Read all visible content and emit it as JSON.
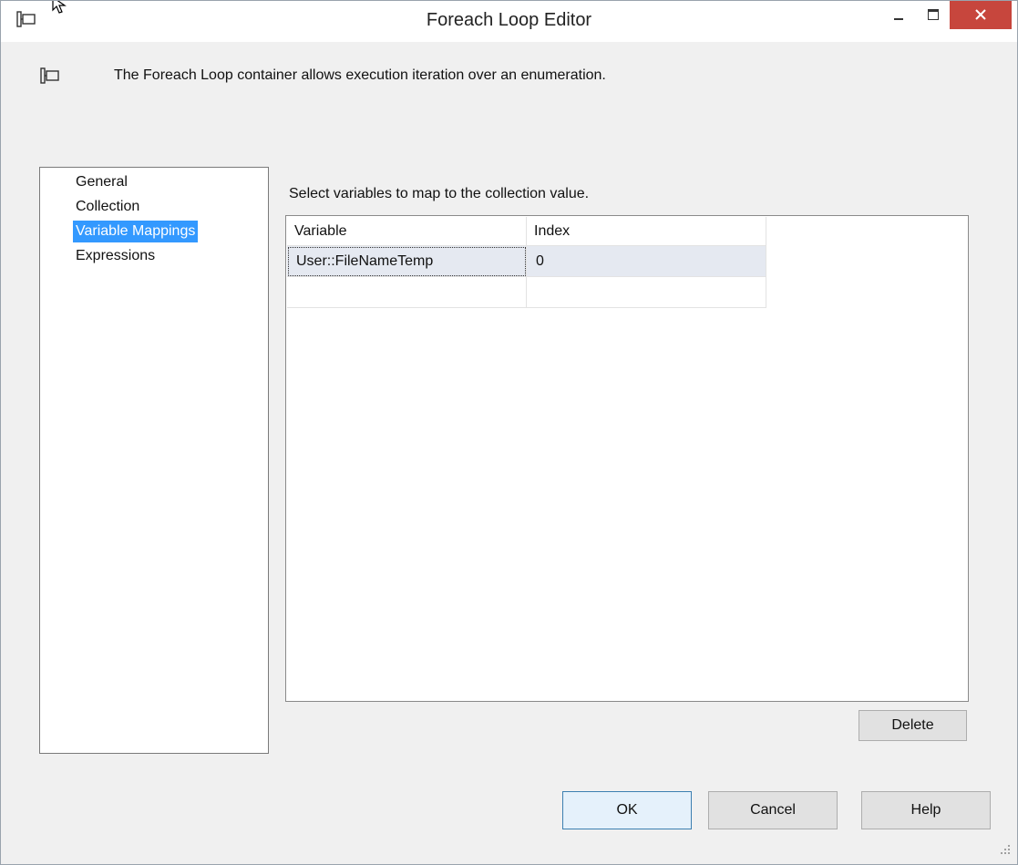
{
  "window": {
    "title": "Foreach Loop Editor",
    "controls": [
      "minimize",
      "maximize",
      "close"
    ]
  },
  "header": {
    "icon": "foreach-loop-icon",
    "description": "The Foreach Loop container allows execution iteration over an enumeration."
  },
  "nav": {
    "items": [
      {
        "label": "General",
        "selected": false
      },
      {
        "label": "Collection",
        "selected": false
      },
      {
        "label": "Variable Mappings",
        "selected": true
      },
      {
        "label": "Expressions",
        "selected": false
      }
    ]
  },
  "mappings": {
    "instruction": "Select variables to map to the collection value.",
    "columns": [
      "Variable",
      "Index"
    ],
    "rows": [
      {
        "variable": "User::FileNameTemp",
        "index": "0"
      },
      {
        "variable": "",
        "index": ""
      }
    ],
    "delete_label": "Delete"
  },
  "buttons": {
    "ok": "OK",
    "cancel": "Cancel",
    "help": "Help"
  },
  "colors": {
    "close_button": "#c7463d",
    "selection": "#3399ff",
    "row_selected": "#e5e9f1"
  }
}
